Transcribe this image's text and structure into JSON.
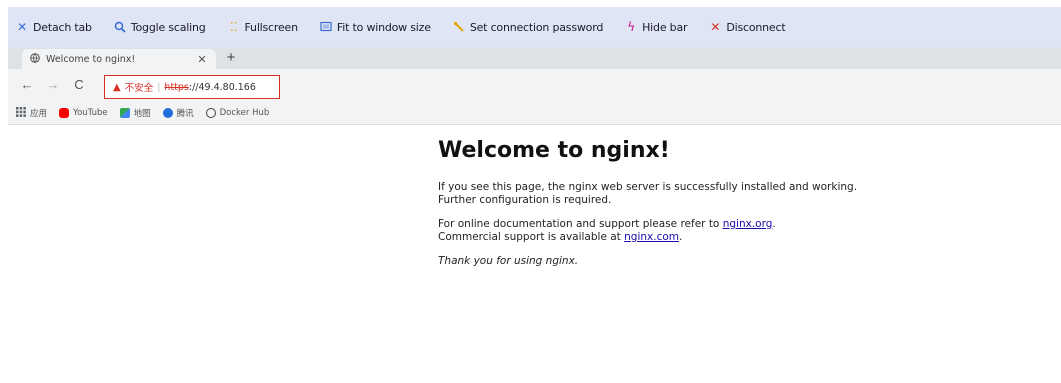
{
  "topbar": {
    "buttons": [
      {
        "label": "Detach tab",
        "icon": "close-icon",
        "color": "#3a6bd6"
      },
      {
        "label": "Toggle scaling",
        "icon": "zoom-icon",
        "color": "#3a6bd6"
      },
      {
        "label": "Fullscreen",
        "icon": "fullscreen-icon",
        "color": "#e0a500"
      },
      {
        "label": "Fit to window size",
        "icon": "fit-window-icon",
        "color": "#3a6bd6"
      },
      {
        "label": "Set connection password",
        "icon": "key-icon",
        "color": "#e0a500"
      },
      {
        "label": "Hide bar",
        "icon": "lightning-icon",
        "color": "#c71585"
      },
      {
        "label": "Disconnect",
        "icon": "disconnect-icon",
        "color": "#d93025"
      }
    ]
  },
  "browser": {
    "tab": {
      "title": "Welcome to nginx!"
    },
    "omnibox": {
      "insecure_label": "不安全",
      "url_scheme": "https",
      "url_host": "://49.4.80.166"
    },
    "bookmarks": [
      {
        "label": "应用",
        "icon": "apps-icon",
        "color": "#5f6368"
      },
      {
        "label": "YouTube",
        "icon": "youtube-icon",
        "color": "#ff0000"
      },
      {
        "label": "地图",
        "icon": "maps-icon",
        "color": "#34a853"
      },
      {
        "label": "腾讯",
        "icon": "tencent-icon",
        "color": "#1e6fd9"
      },
      {
        "label": "Docker Hub",
        "icon": "docker-icon",
        "color": "#444444"
      }
    ]
  },
  "page": {
    "title": "Welcome to nginx!",
    "p1": "If you see this page, the nginx web server is successfully installed and working. Further configuration is required.",
    "p2_before": "For online documentation and support please refer to ",
    "link1": "nginx.org",
    "p2_middle": ".",
    "p2_line2": "Commercial support is available at ",
    "link2": "nginx.com",
    "p2_end": ".",
    "thanks": "Thank you for using nginx."
  }
}
